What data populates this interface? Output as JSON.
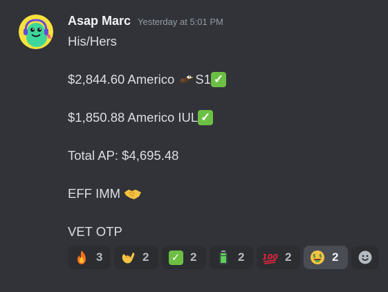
{
  "message": {
    "username": "Asap Marc",
    "timestamp": "Yesterday at 5:01 PM",
    "lines": [
      {
        "text": "His/Hers"
      },
      {
        "text": "$2,844.60 Americo ",
        "emoji1": "eagle-emoji",
        "text2": "S1",
        "emoji2": "check-mark-button-emoji"
      },
      {
        "text": "$1,850.88 Americo IUL",
        "emoji2": "check-mark-button-emoji"
      },
      {
        "text": "Total AP: $4,695.48"
      },
      {
        "text": "EFF IMM ",
        "emoji1": "handshake-emoji"
      },
      {
        "text": "VET OTP"
      }
    ]
  },
  "reactions": [
    {
      "emoji": "fire-emoji",
      "count": "3"
    },
    {
      "emoji": "call-me-hand-emoji",
      "count": "2"
    },
    {
      "emoji": "check-mark-button-emoji",
      "count": "2"
    },
    {
      "emoji": "battery-emoji",
      "count": "2"
    },
    {
      "emoji": "hundred-points-emoji",
      "count": "2"
    },
    {
      "emoji": "money-mouth-face-emoji",
      "count": "2",
      "selected": true
    }
  ],
  "add_reaction": {
    "icon": "add-reaction-smiley-icon"
  },
  "colors": {
    "background": "#323339",
    "reaction_bg": "#2b2d31",
    "reaction_selected_bg": "#4a4c53",
    "username": "#f2f3f5",
    "timestamp": "#949ba4",
    "text": "#dbdee1",
    "check_green": "#6cbf44"
  }
}
